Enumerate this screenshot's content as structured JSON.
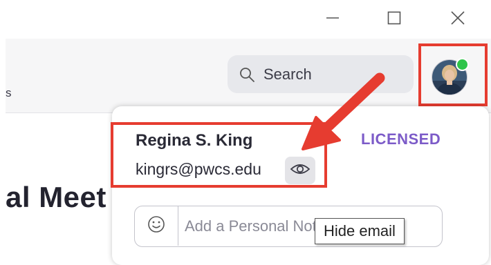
{
  "window_controls": {
    "minimize_icon": "minimize-icon",
    "maximize_icon": "maximize-icon",
    "close_icon": "close-icon"
  },
  "header": {
    "nav_fragment": "s",
    "search": {
      "label": "Search",
      "icon": "search-icon"
    },
    "avatar": {
      "status": "online",
      "status_color": "#2ec44a"
    }
  },
  "main": {
    "title_fragment": "al Meet"
  },
  "profile_menu": {
    "user_name": "Regina S. King",
    "email": "kingrs@pwcs.edu",
    "license": "LICENSED",
    "eye_icon": "eye-icon",
    "personal_note_placeholder": "Add a Personal Note",
    "emoji_icon": "smiley-icon",
    "tooltip": "Hide email"
  },
  "colors": {
    "highlight_red": "#e63c30",
    "license_accent": "#7c5bc8",
    "status_green": "#2ec44a"
  }
}
